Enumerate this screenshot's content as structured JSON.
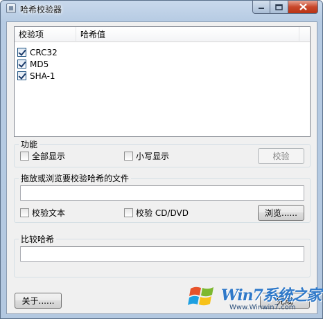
{
  "window": {
    "title": "哈希校验器",
    "controls": {
      "minimize": "minimize-icon",
      "maximize": "maximize-icon",
      "close": "close-icon"
    }
  },
  "list": {
    "headers": [
      "校验项",
      "哈希值"
    ],
    "items": [
      {
        "label": "CRC32",
        "checked": true
      },
      {
        "label": "MD5",
        "checked": true
      },
      {
        "label": "SHA-1",
        "checked": true
      }
    ]
  },
  "function_group": {
    "title": "功能",
    "show_all": "全部显示",
    "lowercase": "小写显示",
    "verify_button": "校验"
  },
  "file_group": {
    "title": "拖放或浏览要校验哈希的文件",
    "path_value": "",
    "verify_text": "校验文本",
    "verify_cd": "校验 CD/DVD",
    "browse_button": "浏览......"
  },
  "compare_group": {
    "title": "比较哈希",
    "hash_value": ""
  },
  "footer": {
    "about_button": "关于......",
    "done_button": "完成"
  },
  "watermark": {
    "brand": "Win7系统之家",
    "url": "Www.Winwin7.com"
  },
  "colors": {
    "close_button": "#c8472b",
    "frame": "#b6cbe3",
    "client": "#f0f0f0"
  }
}
